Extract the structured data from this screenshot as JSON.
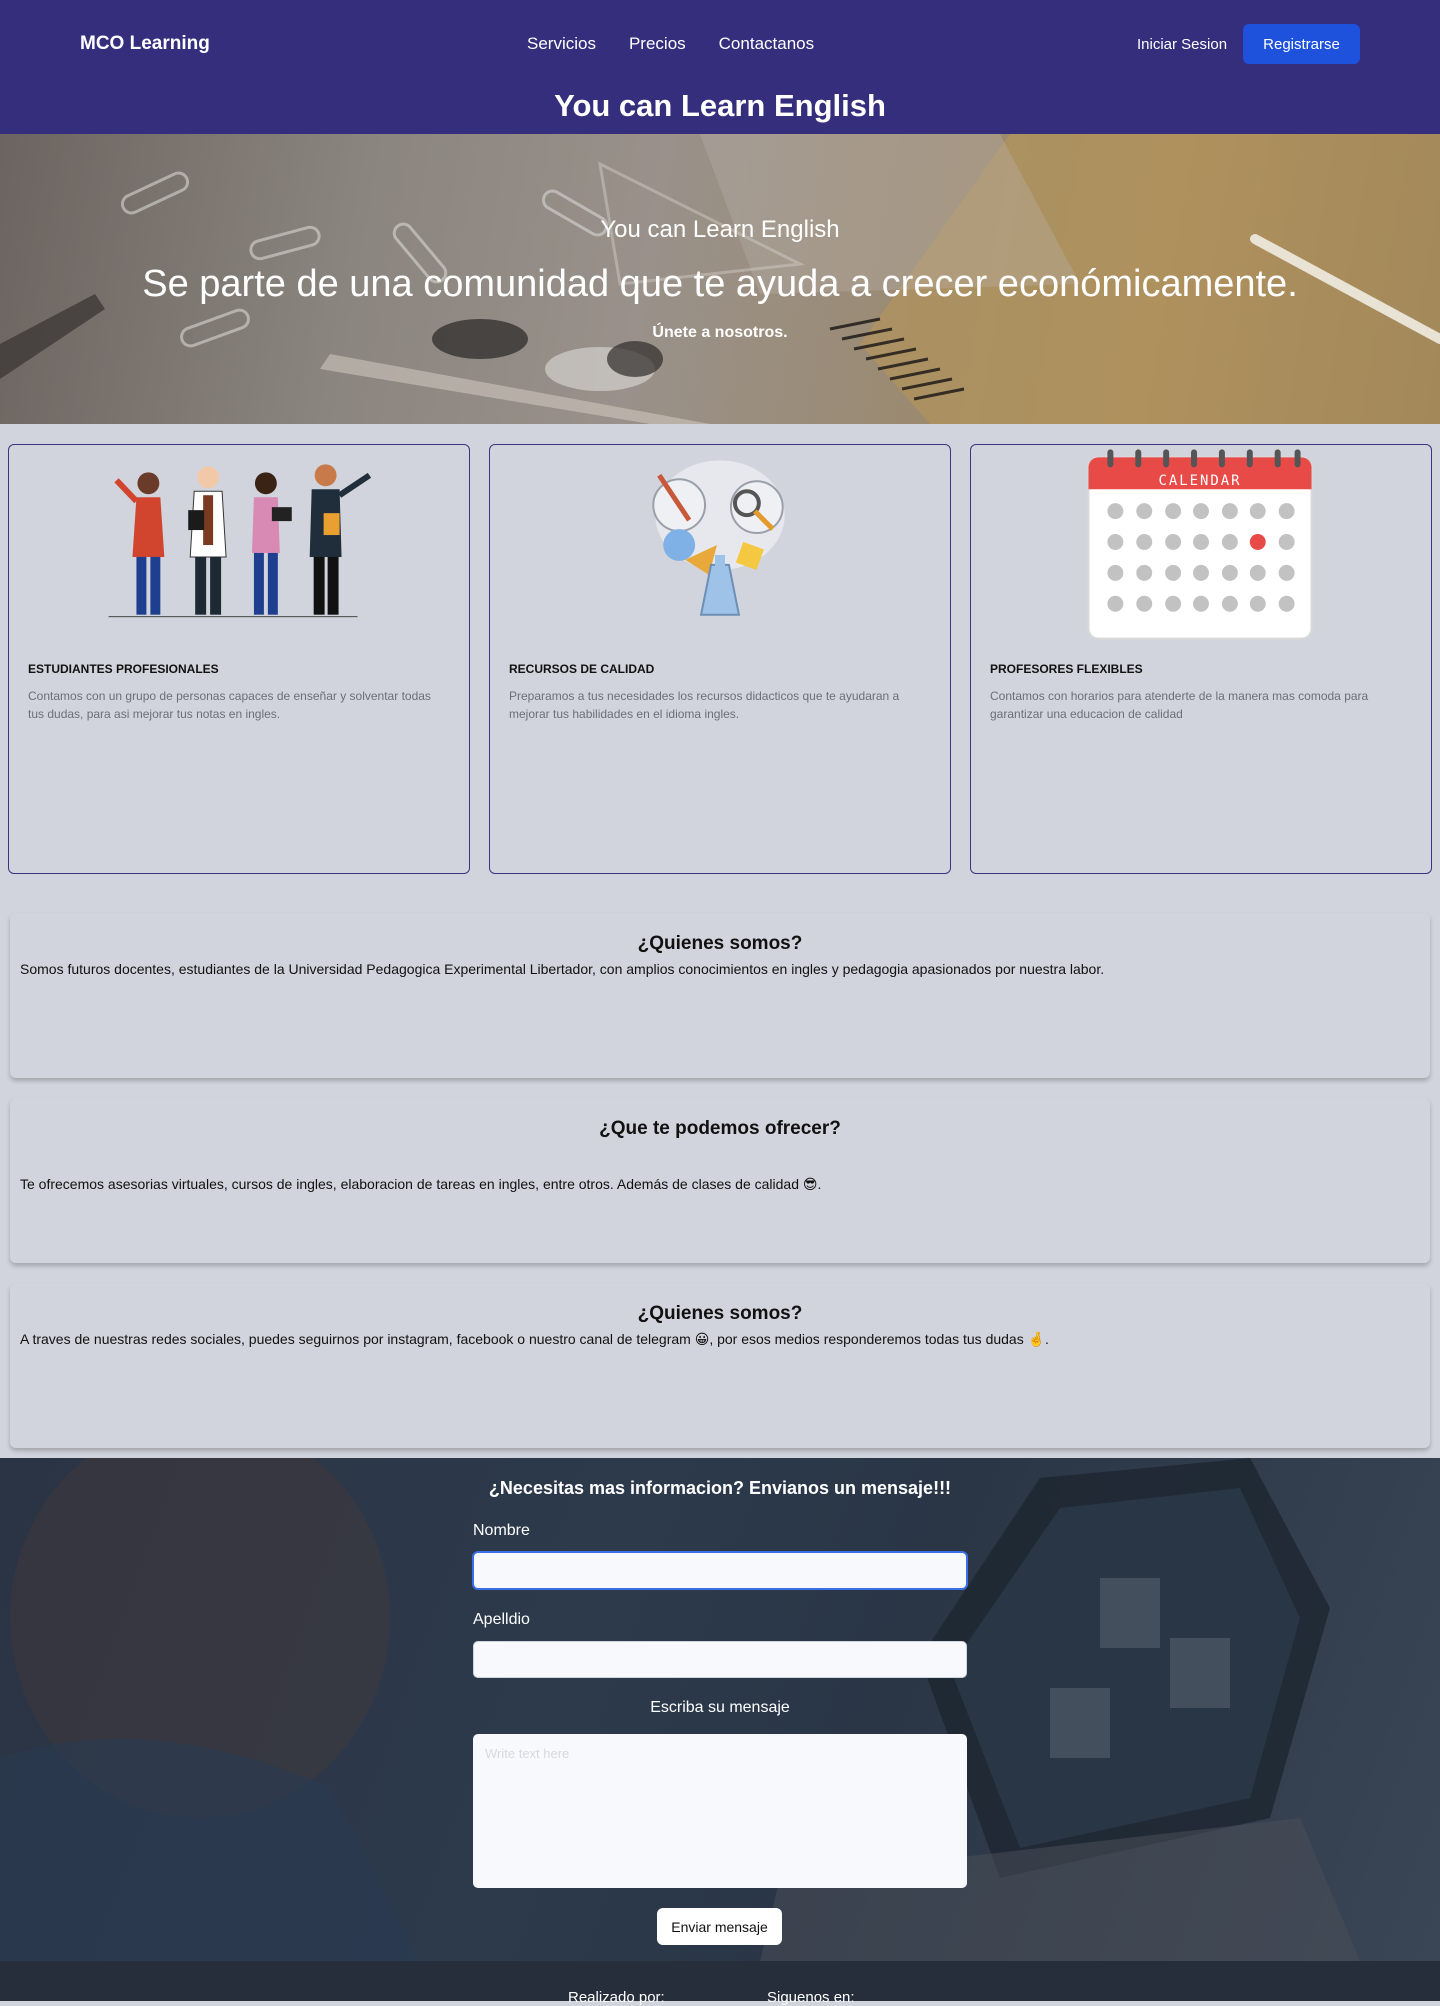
{
  "header": {
    "brand": "MCO Learning",
    "nav": [
      "Servicios",
      "Precios",
      "Contactanos"
    ],
    "login": "Iniciar Sesion",
    "register": "Registrarse",
    "title": "You can Learn English"
  },
  "hero": {
    "subtitle": "You can Learn English",
    "title": "Se parte de una comunidad que te ayuda a crecer económicamente.",
    "cta": "Únete a nosotros."
  },
  "cards": [
    {
      "icon": "team-illustration",
      "title": "ESTUDIANTES PROFESIONALES",
      "text": "Contamos con un grupo de personas capaces de enseñar y solventar todas tus dudas, para asi mejorar tus notas en ingles."
    },
    {
      "icon": "resources-illustration",
      "title": "RECURSOS DE CALIDAD",
      "text": "Preparamos a tus necesidades los recursos didacticos que te ayudaran a mejorar tus habilidades en el idioma ingles."
    },
    {
      "icon": "calendar-illustration",
      "title": "PROFESORES FLEXIBLES",
      "text": "Contamos con horarios para atenderte de la manera mas comoda para garantizar una educacion de calidad",
      "calendar_label": "CALENDAR"
    }
  ],
  "sections": [
    {
      "title": "¿Quienes somos?",
      "text": "Somos futuros docentes, estudiantes de la Universidad Pedagogica Experimental Libertador, con amplios conocimientos en ingles y pedagogia apasionados por nuestra labor."
    },
    {
      "title": "¿Que te podemos ofrecer?",
      "text": "Te ofrecemos asesorias virtuales, cursos de ingles, elaboracion de tareas en ingles, entre otros. Además de clases de calidad 😎."
    },
    {
      "title": "¿Quienes somos?",
      "text": "A traves de nuestras redes sociales, puedes seguirnos por instagram, facebook o nuestro canal de telegram 😀, por esos medios responderemos todas tus dudas 🤞."
    }
  ],
  "contact": {
    "title": "¿Necesitas mas informacion? Envianos un mensaje!!!",
    "name_label": "Nombre",
    "name_value": "",
    "lastname_label": "Apelldio",
    "lastname_value": "",
    "message_label": "Escriba su mensaje",
    "message_placeholder": "Write text here",
    "send": "Enviar mensaje"
  },
  "footer": {
    "made_by": "Realizado por:",
    "follow": "Siguenos en:"
  },
  "colors": {
    "header_bg": "#342e7c",
    "button_blue": "#1e52dc",
    "card_border": "#3a3580",
    "page_bg": "#d1d4dc",
    "footer_bg": "#262e3b"
  }
}
